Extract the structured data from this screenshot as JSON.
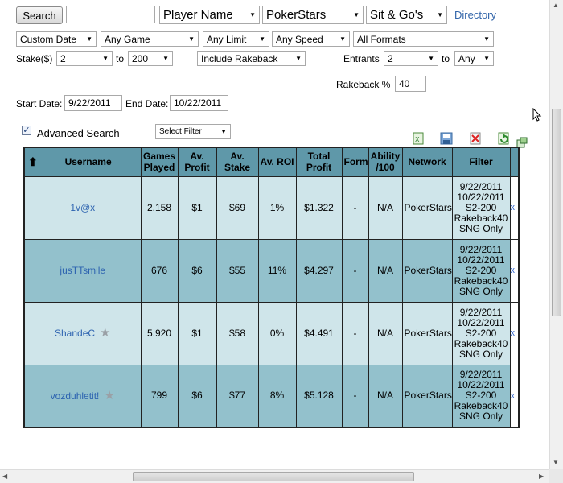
{
  "toolbar": {
    "search_label": "Search",
    "search_value": "",
    "type_select": "Player Name",
    "network_select": "PokerStars",
    "game_select": "Sit & Go's",
    "directory_label": "Directory"
  },
  "filters": {
    "date_range": "Custom Date",
    "game": "Any Game",
    "limit": "Any Limit",
    "speed": "Any Speed",
    "formats": "All Formats",
    "stake_label": "Stake($)",
    "stake_from": "2",
    "to_label_1": "to",
    "stake_to": "200",
    "rakeback_select": "Include Rakeback",
    "entrants_label": "Entrants",
    "entrants_from": "2",
    "to_label_2": "to",
    "entrants_to": "Any",
    "rakeback_pct_label": "Rakeback %",
    "rakeback_pct_value": "40",
    "start_date_label": "Start Date:",
    "start_date_value": "9/22/2011",
    "end_date_label": "End Date:",
    "end_date_value": "10/22/2011",
    "advanced_search_label": "Advanced Search",
    "advanced_search_checked": true,
    "select_filter": "Select Filter"
  },
  "icons": [
    "export-excel-icon",
    "save-icon",
    "delete-icon",
    "refresh-icon",
    "popout-icon"
  ],
  "table": {
    "columns": [
      "Username",
      "Games Played",
      "Av. Profit",
      "Av. Stake",
      "Av. ROI",
      "Total Profit",
      "Form",
      "Ability /100",
      "Network",
      "Filter"
    ],
    "rows": [
      {
        "username": "1v@x",
        "star": false,
        "games": "2.158",
        "profit": "$1",
        "stake": "$69",
        "roi": "1%",
        "total": "$1.322",
        "form": "-",
        "ability": "N/A",
        "network": "PokerStars",
        "filter": [
          "9/22/2011",
          "10/22/2011",
          "S2-200",
          "Rakeback40",
          "SNG Only"
        ],
        "remove": "x"
      },
      {
        "username": "jusTTsmile",
        "star": false,
        "games": "676",
        "profit": "$6",
        "stake": "$55",
        "roi": "11%",
        "total": "$4.297",
        "form": "-",
        "ability": "N/A",
        "network": "PokerStars",
        "filter": [
          "9/22/2011",
          "10/22/2011",
          "S2-200",
          "Rakeback40",
          "SNG Only"
        ],
        "remove": "x"
      },
      {
        "username": "ShandeC",
        "star": true,
        "games": "5.920",
        "profit": "$1",
        "stake": "$58",
        "roi": "0%",
        "total": "$4.491",
        "form": "-",
        "ability": "N/A",
        "network": "PokerStars",
        "filter": [
          "9/22/2011",
          "10/22/2011",
          "S2-200",
          "Rakeback40",
          "SNG Only"
        ],
        "remove": "x"
      },
      {
        "username": "vozduhletit!",
        "star": true,
        "games": "799",
        "profit": "$6",
        "stake": "$77",
        "roi": "8%",
        "total": "$5.128",
        "form": "-",
        "ability": "N/A",
        "network": "PokerStars",
        "filter": [
          "9/22/2011",
          "10/22/2011",
          "S2-200",
          "Rakeback40",
          "SNG Only"
        ],
        "remove": "x"
      }
    ]
  }
}
